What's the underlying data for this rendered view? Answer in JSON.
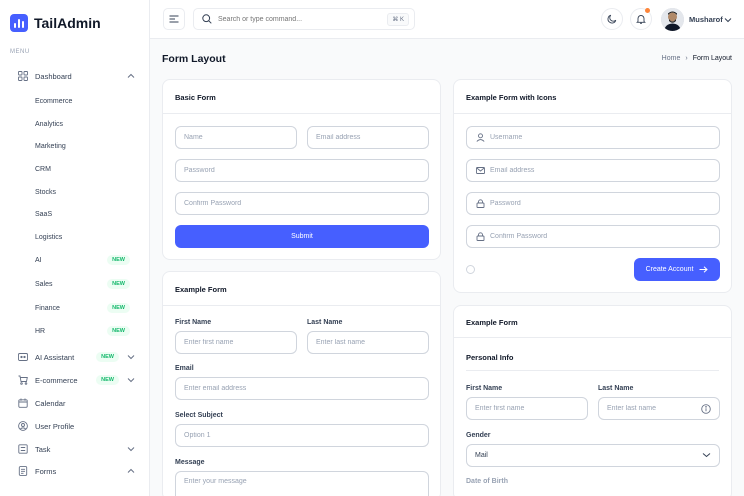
{
  "app": {
    "logo_text": "TailAdmin"
  },
  "sidebar": {
    "menu_label": "MENU",
    "dashboard": {
      "label": "Dashboard",
      "icon": "grid-icon"
    },
    "dashboard_sub": [
      {
        "label": "Ecommerce"
      },
      {
        "label": "Analytics"
      },
      {
        "label": "Marketing"
      },
      {
        "label": "CRM"
      },
      {
        "label": "Stocks"
      },
      {
        "label": "SaaS"
      },
      {
        "label": "Logistics"
      },
      {
        "label": "AI",
        "badge": "NEW"
      },
      {
        "label": "Sales",
        "badge": "NEW"
      },
      {
        "label": "Finance",
        "badge": "NEW"
      },
      {
        "label": "HR",
        "badge": "NEW"
      }
    ],
    "ai_assistant": {
      "label": "AI Assistant",
      "badge": "NEW"
    },
    "ecommerce": {
      "label": "E-commerce",
      "badge": "NEW"
    },
    "calendar": {
      "label": "Calendar"
    },
    "user_profile": {
      "label": "User Profile"
    },
    "task": {
      "label": "Task"
    },
    "forms": {
      "label": "Forms"
    }
  },
  "header": {
    "search_placeholder": "Search or type command...",
    "shortcut": "⌘ K",
    "user_name": "Musharof"
  },
  "page": {
    "title": "Form Layout",
    "breadcrumb_home": "Home",
    "breadcrumb_sep": "›",
    "breadcrumb_current": "Form Layout"
  },
  "basic_form": {
    "title": "Basic Form",
    "name_placeholder": "Name",
    "email_placeholder": "Email address",
    "password_placeholder": "Password",
    "confirm_placeholder": "Confirm Password",
    "submit_label": "Submit"
  },
  "icon_form": {
    "title": "Example Form with Icons",
    "username_placeholder": "Username",
    "email_placeholder": "Email address",
    "password_placeholder": "Password",
    "confirm_placeholder": "Confirm Password",
    "create_label": "Create Account"
  },
  "example_form": {
    "title": "Example Form",
    "first_name_label": "First Name",
    "first_name_placeholder": "Enter first name",
    "last_name_label": "Last Name",
    "last_name_placeholder": "Enter last name",
    "email_label": "Email",
    "email_placeholder": "Enter email address",
    "subject_label": "Select Subject",
    "subject_placeholder": "Option 1",
    "message_label": "Message",
    "message_placeholder": "Enter your message"
  },
  "example_form2": {
    "title": "Example Form",
    "section_title": "Personal Info",
    "first_name_label": "First Name",
    "first_name_placeholder": "Enter first name",
    "last_name_label": "Last Name",
    "last_name_placeholder": "Enter last name",
    "gender_label": "Gender",
    "gender_value": "Mail",
    "dob_label": "Date of Birth"
  },
  "colors": {
    "accent": "#465fff",
    "badge_bg": "#ecfdf3",
    "badge_text": "#12b76a",
    "notification_dot": "#fd853a"
  }
}
